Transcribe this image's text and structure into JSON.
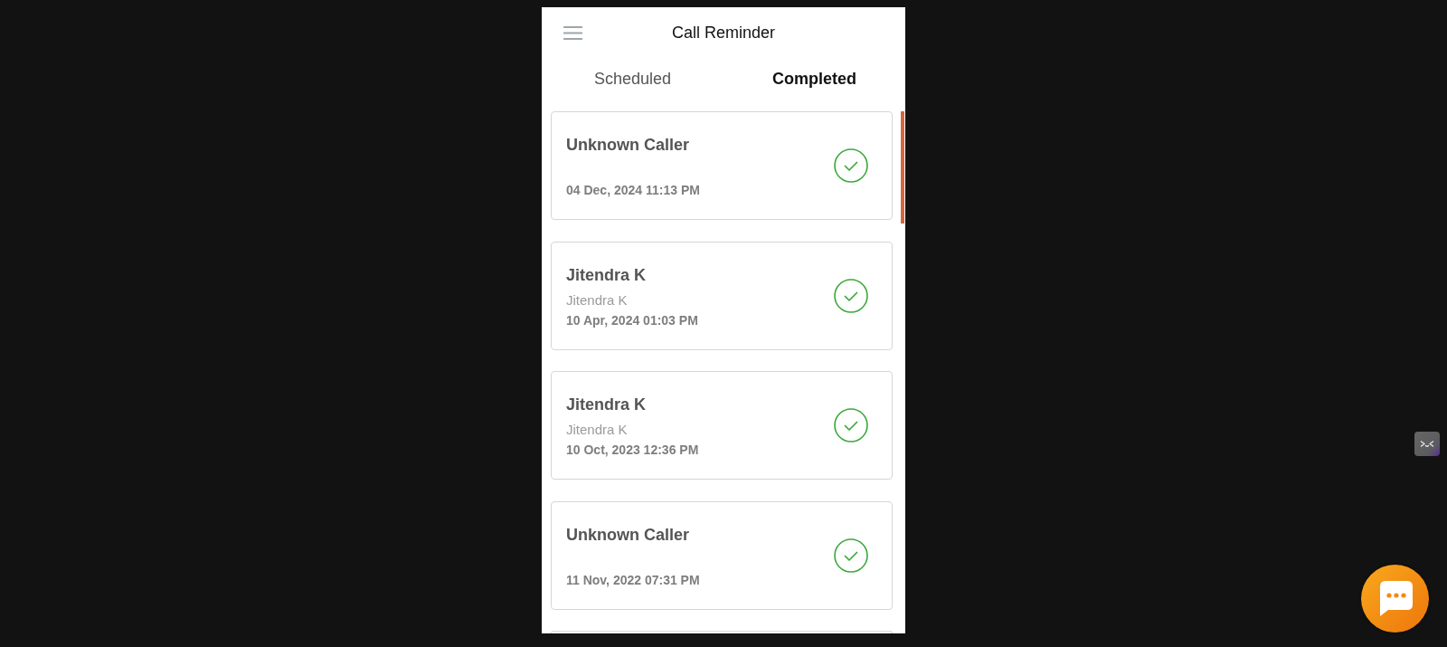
{
  "header": {
    "title": "Call Reminder"
  },
  "tabs": [
    {
      "label": "Scheduled",
      "selected": false
    },
    {
      "label": "Completed",
      "selected": true
    }
  ],
  "reminder_list": {
    "items": [
      {
        "name": "Unknown Caller",
        "date": "04 Dec, 2024 11:13 PM",
        "done": true
      },
      {
        "name": "Jitendra K",
        "contact": "Jitendra K",
        "date": "10 Apr, 2024 01:03 PM",
        "done": true
      },
      {
        "name": "Jitendra K",
        "contact": "Jitendra K",
        "date": "10 Oct, 2023 12:36 PM",
        "done": true
      },
      {
        "name": "Unknown Caller",
        "date": "11 Nov, 2022 07:31 PM",
        "done": true
      }
    ],
    "more_below": true
  }
}
